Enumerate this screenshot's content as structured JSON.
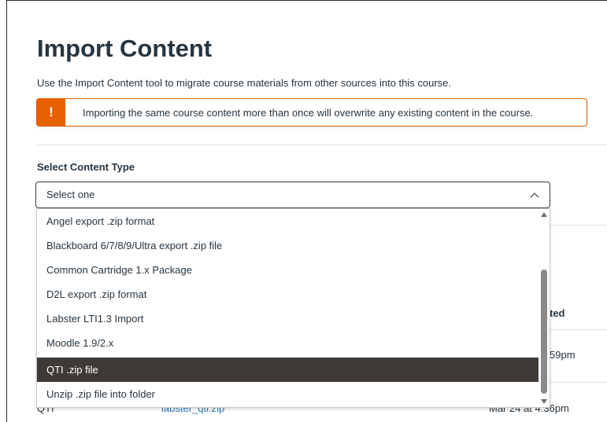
{
  "page": {
    "title": "Import Content",
    "intro": "Use the Import Content tool to migrate course materials from other sources into this course."
  },
  "alert": {
    "icon_glyph": "!",
    "icon": "warning-icon",
    "text": "Importing the same course content more than once will overwrite any existing content in the course.",
    "color": "#e66000"
  },
  "select": {
    "label": "Select Content Type",
    "value": "Select one",
    "chevron_icon": "chevron-up-icon",
    "options": [
      {
        "label": "Angel export .zip format",
        "selected": false
      },
      {
        "label": "Blackboard 6/7/8/9/Ultra export .zip file",
        "selected": false
      },
      {
        "label": "Common Cartridge 1.x Package",
        "selected": false
      },
      {
        "label": "D2L export .zip format",
        "selected": false
      },
      {
        "label": "Labster LTI1.3 Import",
        "selected": false
      },
      {
        "label": "Moodle 1.9/2.x",
        "selected": false
      },
      {
        "label": "QTI .zip file",
        "selected": true
      },
      {
        "label": "Unzip .zip file into folder",
        "selected": false
      }
    ],
    "selected_color": "#3f3a35"
  },
  "background": {
    "column_header_partial": "ted",
    "row1_time_partial": "59pm",
    "row2_type_partial": "QTI",
    "row2_link_partial": "labster_qti.zip",
    "row2_time_partial": "Mar 24 at 4:36pm"
  }
}
